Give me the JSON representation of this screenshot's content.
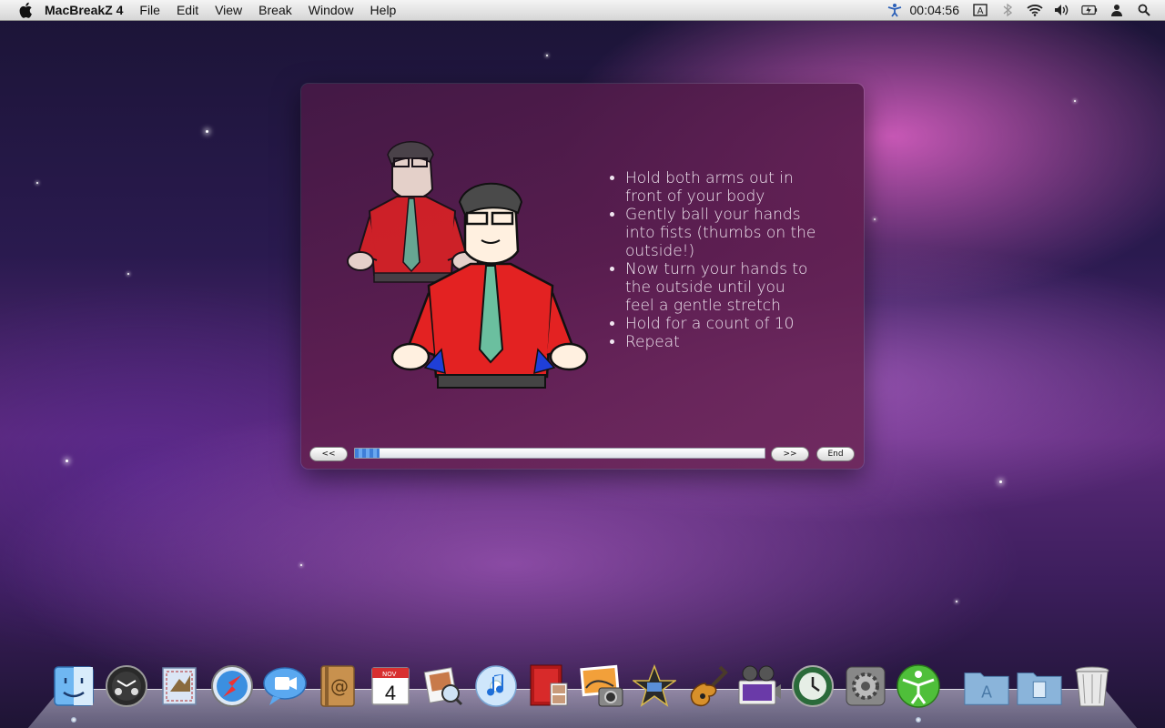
{
  "menubar": {
    "app_name": "MacBreakZ 4",
    "menus": [
      "File",
      "Edit",
      "View",
      "Break",
      "Window",
      "Help"
    ],
    "clock": "00:04:56",
    "status_icons": [
      "stretch-figure-icon",
      "keyboard-input-icon",
      "bluetooth-icon",
      "wifi-icon",
      "volume-icon",
      "battery-icon",
      "user-icon",
      "spotlight-icon"
    ]
  },
  "exercise": {
    "instructions": [
      "Hold both arms out in front of your body",
      "Gently ball your hands into fists (thumbs on the outside!)",
      "Now turn your hands to the outside until you feel a gentle stretch",
      "Hold for a count of 10",
      "Repeat"
    ],
    "illustration": "two figures of a man in red shirt and tie with arms out, turning fists outward",
    "progress_fraction": 0.06
  },
  "controls": {
    "prev_label": "<<",
    "next_label": ">>",
    "end_label": "End"
  },
  "dock": {
    "items": [
      "finder-icon",
      "dashboard-icon",
      "mail-icon",
      "safari-icon",
      "ichat-icon",
      "address-book-icon",
      "ical-icon",
      "preview-icon",
      "itunes-icon",
      "photo-booth-icon",
      "iphoto-icon",
      "imovie-icon",
      "garageband-icon",
      "dvd-player-icon",
      "time-machine-icon",
      "system-preferences-icon",
      "macbreakz-icon",
      "applications-folder-icon",
      "documents-folder-icon",
      "trash-icon"
    ],
    "ical_month": "NOV",
    "ical_day": "4"
  }
}
